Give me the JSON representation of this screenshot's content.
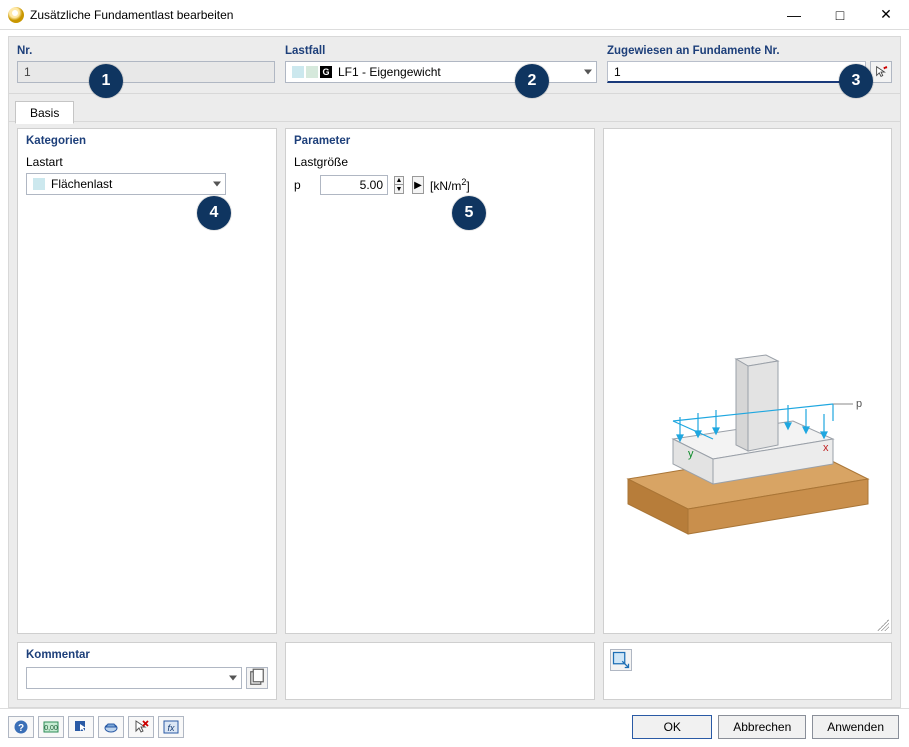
{
  "window": {
    "title": "Zusätzliche Fundamentlast bearbeiten"
  },
  "top": {
    "nr_label": "Nr.",
    "nr_value": "1",
    "lastfall_label": "Lastfall",
    "lastfall_value": "LF1 - Eigengewicht",
    "lastfall_tag": "G",
    "assigned_label": "Zugewiesen an Fundamente Nr.",
    "assigned_value": "1"
  },
  "tabs": {
    "basis": "Basis"
  },
  "kategorien": {
    "header": "Kategorien",
    "lastart_label": "Lastart",
    "lastart_value": "Flächenlast"
  },
  "parameter": {
    "header": "Parameter",
    "size_label": "Lastgröße",
    "sym": "p",
    "value": "5.00",
    "unit_prefix": "[kN/m",
    "unit_sup": "2",
    "unit_suffix": "]"
  },
  "viewer": {
    "axis_x": "x",
    "axis_y": "y",
    "load_label": "p"
  },
  "kommentar": {
    "header": "Kommentar"
  },
  "buttons": {
    "ok": "OK",
    "cancel": "Abbrechen",
    "apply": "Anwenden"
  },
  "callouts": {
    "c1": "1",
    "c2": "2",
    "c3": "3",
    "c4": "4",
    "c5": "5"
  }
}
